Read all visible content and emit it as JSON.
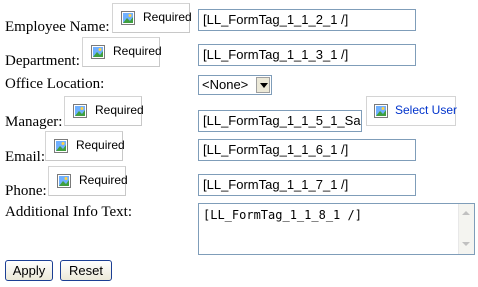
{
  "form": {
    "employee_name": {
      "label": "Employee Name:",
      "required": "Required",
      "value": "[LL_FormTag_1_1_2_1 /]"
    },
    "department": {
      "label": "Department:",
      "required": "Required",
      "value": "[LL_FormTag_1_1_3_1 /]"
    },
    "office_location": {
      "label": "Office Location:",
      "selected": "<None>"
    },
    "manager": {
      "label": "Manager:",
      "required": "Required",
      "value": "[LL_FormTag_1_1_5_1_Sa",
      "select_user": "Select User"
    },
    "email": {
      "label": "Email:",
      "required": "Required",
      "value": "[LL_FormTag_1_1_6_1 /]"
    },
    "phone": {
      "label": "Phone:",
      "required": "Required",
      "value": "[LL_FormTag_1_1_7_1 /]"
    },
    "additional_info": {
      "label": "Additional Info Text:",
      "value": "[LL_FormTag_1_1_8_1 /]"
    }
  },
  "buttons": {
    "apply": "Apply",
    "reset": "Reset"
  },
  "icons": {
    "required": "image-icon",
    "select_user": "image-icon"
  }
}
